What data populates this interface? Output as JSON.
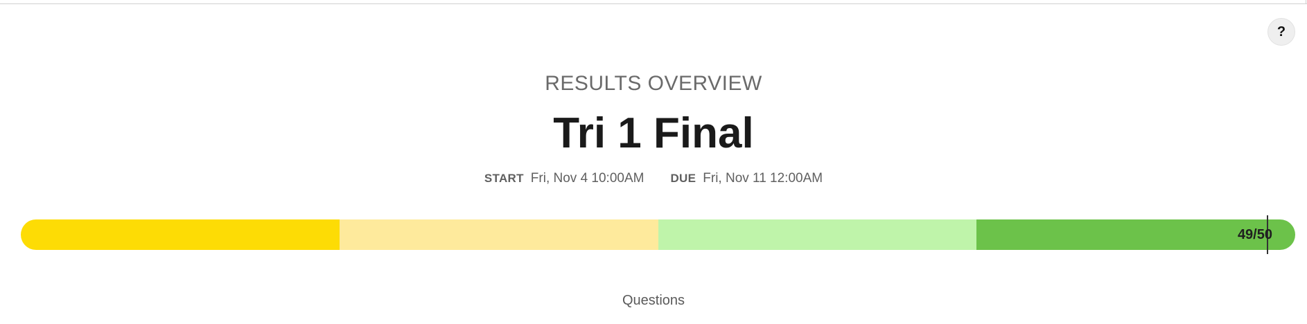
{
  "help": {
    "label": "?"
  },
  "header": {
    "overline": "RESULTS OVERVIEW",
    "title": "Tri 1 Final"
  },
  "dates": {
    "start_label": "START",
    "start_value": "Fri, Nov 4 10:00AM",
    "due_label": "DUE",
    "due_value": "Fri, Nov 11 12:00AM"
  },
  "score": {
    "text": "49/50",
    "earned": 49,
    "possible": 50,
    "band_colors": [
      "#fddc05",
      "#feea9c",
      "#bff4aa",
      "#6cc24a"
    ]
  },
  "section": {
    "label": "Questions"
  }
}
